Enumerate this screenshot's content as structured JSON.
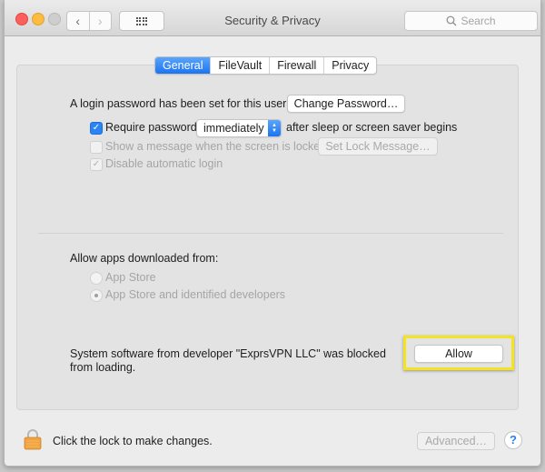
{
  "window": {
    "title": "Security & Privacy",
    "search_placeholder": "Search",
    "nav": {
      "back_icon": "chevron-left",
      "forward_icon": "chevron-right",
      "grid_icon": "show-all-grid"
    }
  },
  "tabs": [
    {
      "label": "General",
      "active": true
    },
    {
      "label": "FileVault",
      "active": false
    },
    {
      "label": "Firewall",
      "active": false
    },
    {
      "label": "Privacy",
      "active": false
    }
  ],
  "general": {
    "login_password_text": "A login password has been set for this user",
    "change_password_button": "Change Password…",
    "require_password": {
      "label": "Require password",
      "checked": true
    },
    "require_password_select": {
      "value": "immediately"
    },
    "after_sleep_text": "after sleep or screen saver begins",
    "show_message": {
      "label": "Show a message when the screen is locked",
      "checked": false,
      "enabled": false
    },
    "set_lock_message_button": "Set Lock Message…",
    "disable_auto_login": {
      "label": "Disable automatic login",
      "checked": true,
      "enabled": false,
      "check_glyph": "✓"
    },
    "require_check_glyph": "✓"
  },
  "allow_apps": {
    "heading": "Allow apps downloaded from:",
    "options": [
      {
        "label": "App Store",
        "selected": false,
        "enabled": false
      },
      {
        "label": "App Store and identified developers",
        "selected": true,
        "enabled": false
      }
    ]
  },
  "blocked": {
    "message_line1": "System software from developer \"ExprsVPN LLC\" was blocked",
    "message_line2": "from loading.",
    "allow_button": "Allow",
    "highlight_color": "#f4e31f"
  },
  "footer": {
    "lock_text": "Click the lock to make changes.",
    "advanced_button": "Advanced…",
    "help_button": "?"
  },
  "colors": {
    "accent": "#1b74f1",
    "lock": "#f0a340"
  }
}
